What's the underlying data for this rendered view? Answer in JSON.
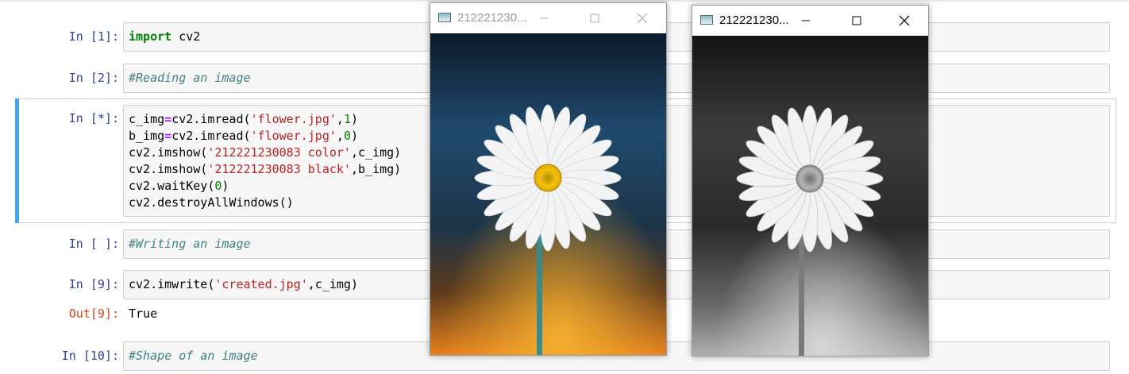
{
  "notebook": {
    "cells": [
      {
        "prompt": "In [1]:",
        "code_html": "<span class=\"kw\">import</span> cv2"
      },
      {
        "prompt": "In [2]:",
        "code_html": "<span class=\"cmt\">#Reading an image</span>"
      },
      {
        "prompt": "In [*]:",
        "code_html": "c_img<span class=\"op\">=</span>cv2.imread(<span class=\"str\">'flower.jpg'</span>,<span class=\"num\">1</span>)\nb_img<span class=\"op\">=</span>cv2.imread(<span class=\"str\">'flower.jpg'</span>,<span class=\"num\">0</span>)\ncv2.imshow(<span class=\"str\">'212221230083 color'</span>,c_img)\ncv2.imshow(<span class=\"str\">'212221230083 black'</span>,b_img)\ncv2.waitKey(<span class=\"num\">0</span>)\ncv2.destroyAllWindows()"
      },
      {
        "prompt": "In [ ]:",
        "code_html": "<span class=\"cmt\">#Writing an image</span>"
      },
      {
        "prompt": "In [9]:",
        "code_html": "cv2.imwrite(<span class=\"str\">'created.jpg'</span>,c_img)"
      },
      {
        "prompt": "In [10]:",
        "code_html": "<span class=\"cmt\">#Shape of an image</span>"
      }
    ],
    "output": {
      "prompt": "Out[9]:",
      "text": "True"
    }
  },
  "windows": {
    "color": {
      "title": "212221230..."
    },
    "black": {
      "title": "212221230..."
    }
  },
  "colors": {
    "prompt_in": "#303f9f",
    "prompt_out": "#d84315",
    "selected_bar": "#42a5f5"
  }
}
